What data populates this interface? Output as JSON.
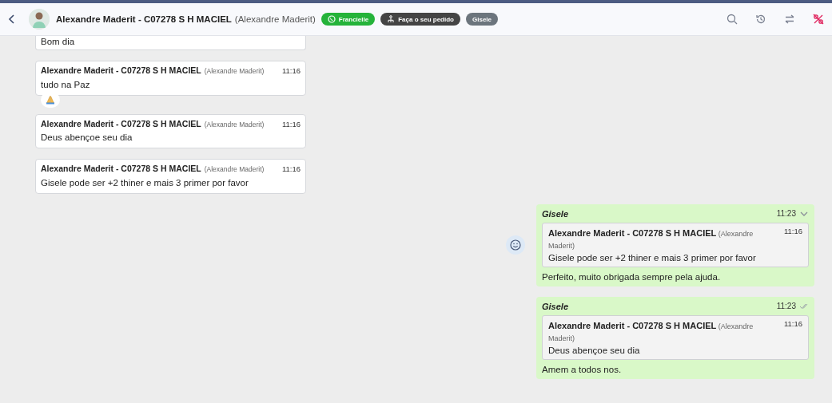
{
  "header": {
    "title": "Alexandre Maderit - C07278 S H MACIEL",
    "subtitle": "(Alexandre Maderit)",
    "tags": [
      {
        "label": "Francielle",
        "kind": "whatsapp",
        "color": "#25b33a"
      },
      {
        "label": "Faça o seu pedido",
        "kind": "flow",
        "color": "#444444"
      },
      {
        "label": "Gisele",
        "kind": "plain",
        "color": "#6c757d"
      }
    ]
  },
  "messages": [
    {
      "kind": "incoming",
      "text": "Bom dia"
    },
    {
      "kind": "incoming",
      "sender": "Alexandre Maderit - C07278 S H MACIEL",
      "alias": "(Alexandre Maderit)",
      "time": "11:16",
      "text": "tudo na Paz",
      "reacted": true
    },
    {
      "kind": "incoming",
      "sender": "Alexandre Maderit - C07278 S H MACIEL",
      "alias": "(Alexandre Maderit)",
      "time": "11:16",
      "text": "Deus abençoe seu dia",
      "reacted": false
    },
    {
      "kind": "incoming",
      "sender": "Alexandre Maderit - C07278 S H MACIEL",
      "alias": "(Alexandre Maderit)",
      "time": "11:16",
      "text": "Gisele pode ser +2 thiner e mais 3 primer por favor",
      "reacted": false
    },
    {
      "kind": "outgoing",
      "sender": "Gisele",
      "time": "11:23",
      "hovered": true,
      "quote": {
        "sender": "**Alexandre Maderit - C07278 S H MACIEL** (Alexandre Maderit)",
        "time": "11:16",
        "text": "Gisele pode ser +2 thiner e mais 3 primer por favor"
      },
      "text": "Perfeito, muito obrigada sempre pela ajuda."
    },
    {
      "kind": "outgoing",
      "sender": "Gisele",
      "time": "11:23",
      "hovered": false,
      "quote": {
        "sender": "**Alexandre Maderit - C07278 S H MACIEL** (Alexandre Maderit)",
        "time": "11:16",
        "text": "Deus abençoe seu dia"
      },
      "text": "Amem a todos nos."
    }
  ]
}
